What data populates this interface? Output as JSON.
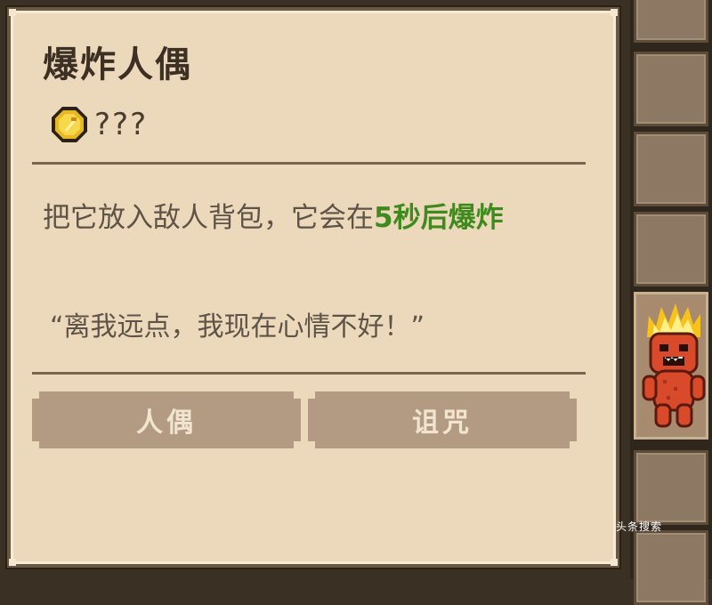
{
  "item": {
    "name": "爆炸人偶",
    "price": "???",
    "description_prefix": "把它放入敌人背包，它会在",
    "description_highlight": "5秒后爆炸",
    "quote": "“离我远点，我现在心情不好！”",
    "tags": [
      "人偶",
      "诅咒"
    ],
    "coin_icon": "gold-coin-icon"
  },
  "colors": {
    "highlight": "#3f8a1c",
    "panel_bg": "#ecd9bb",
    "tag_bg": "#b29b82"
  },
  "sidebar": {
    "doll_icon": "explosive-doll-icon"
  },
  "watermark": "头条搜索"
}
